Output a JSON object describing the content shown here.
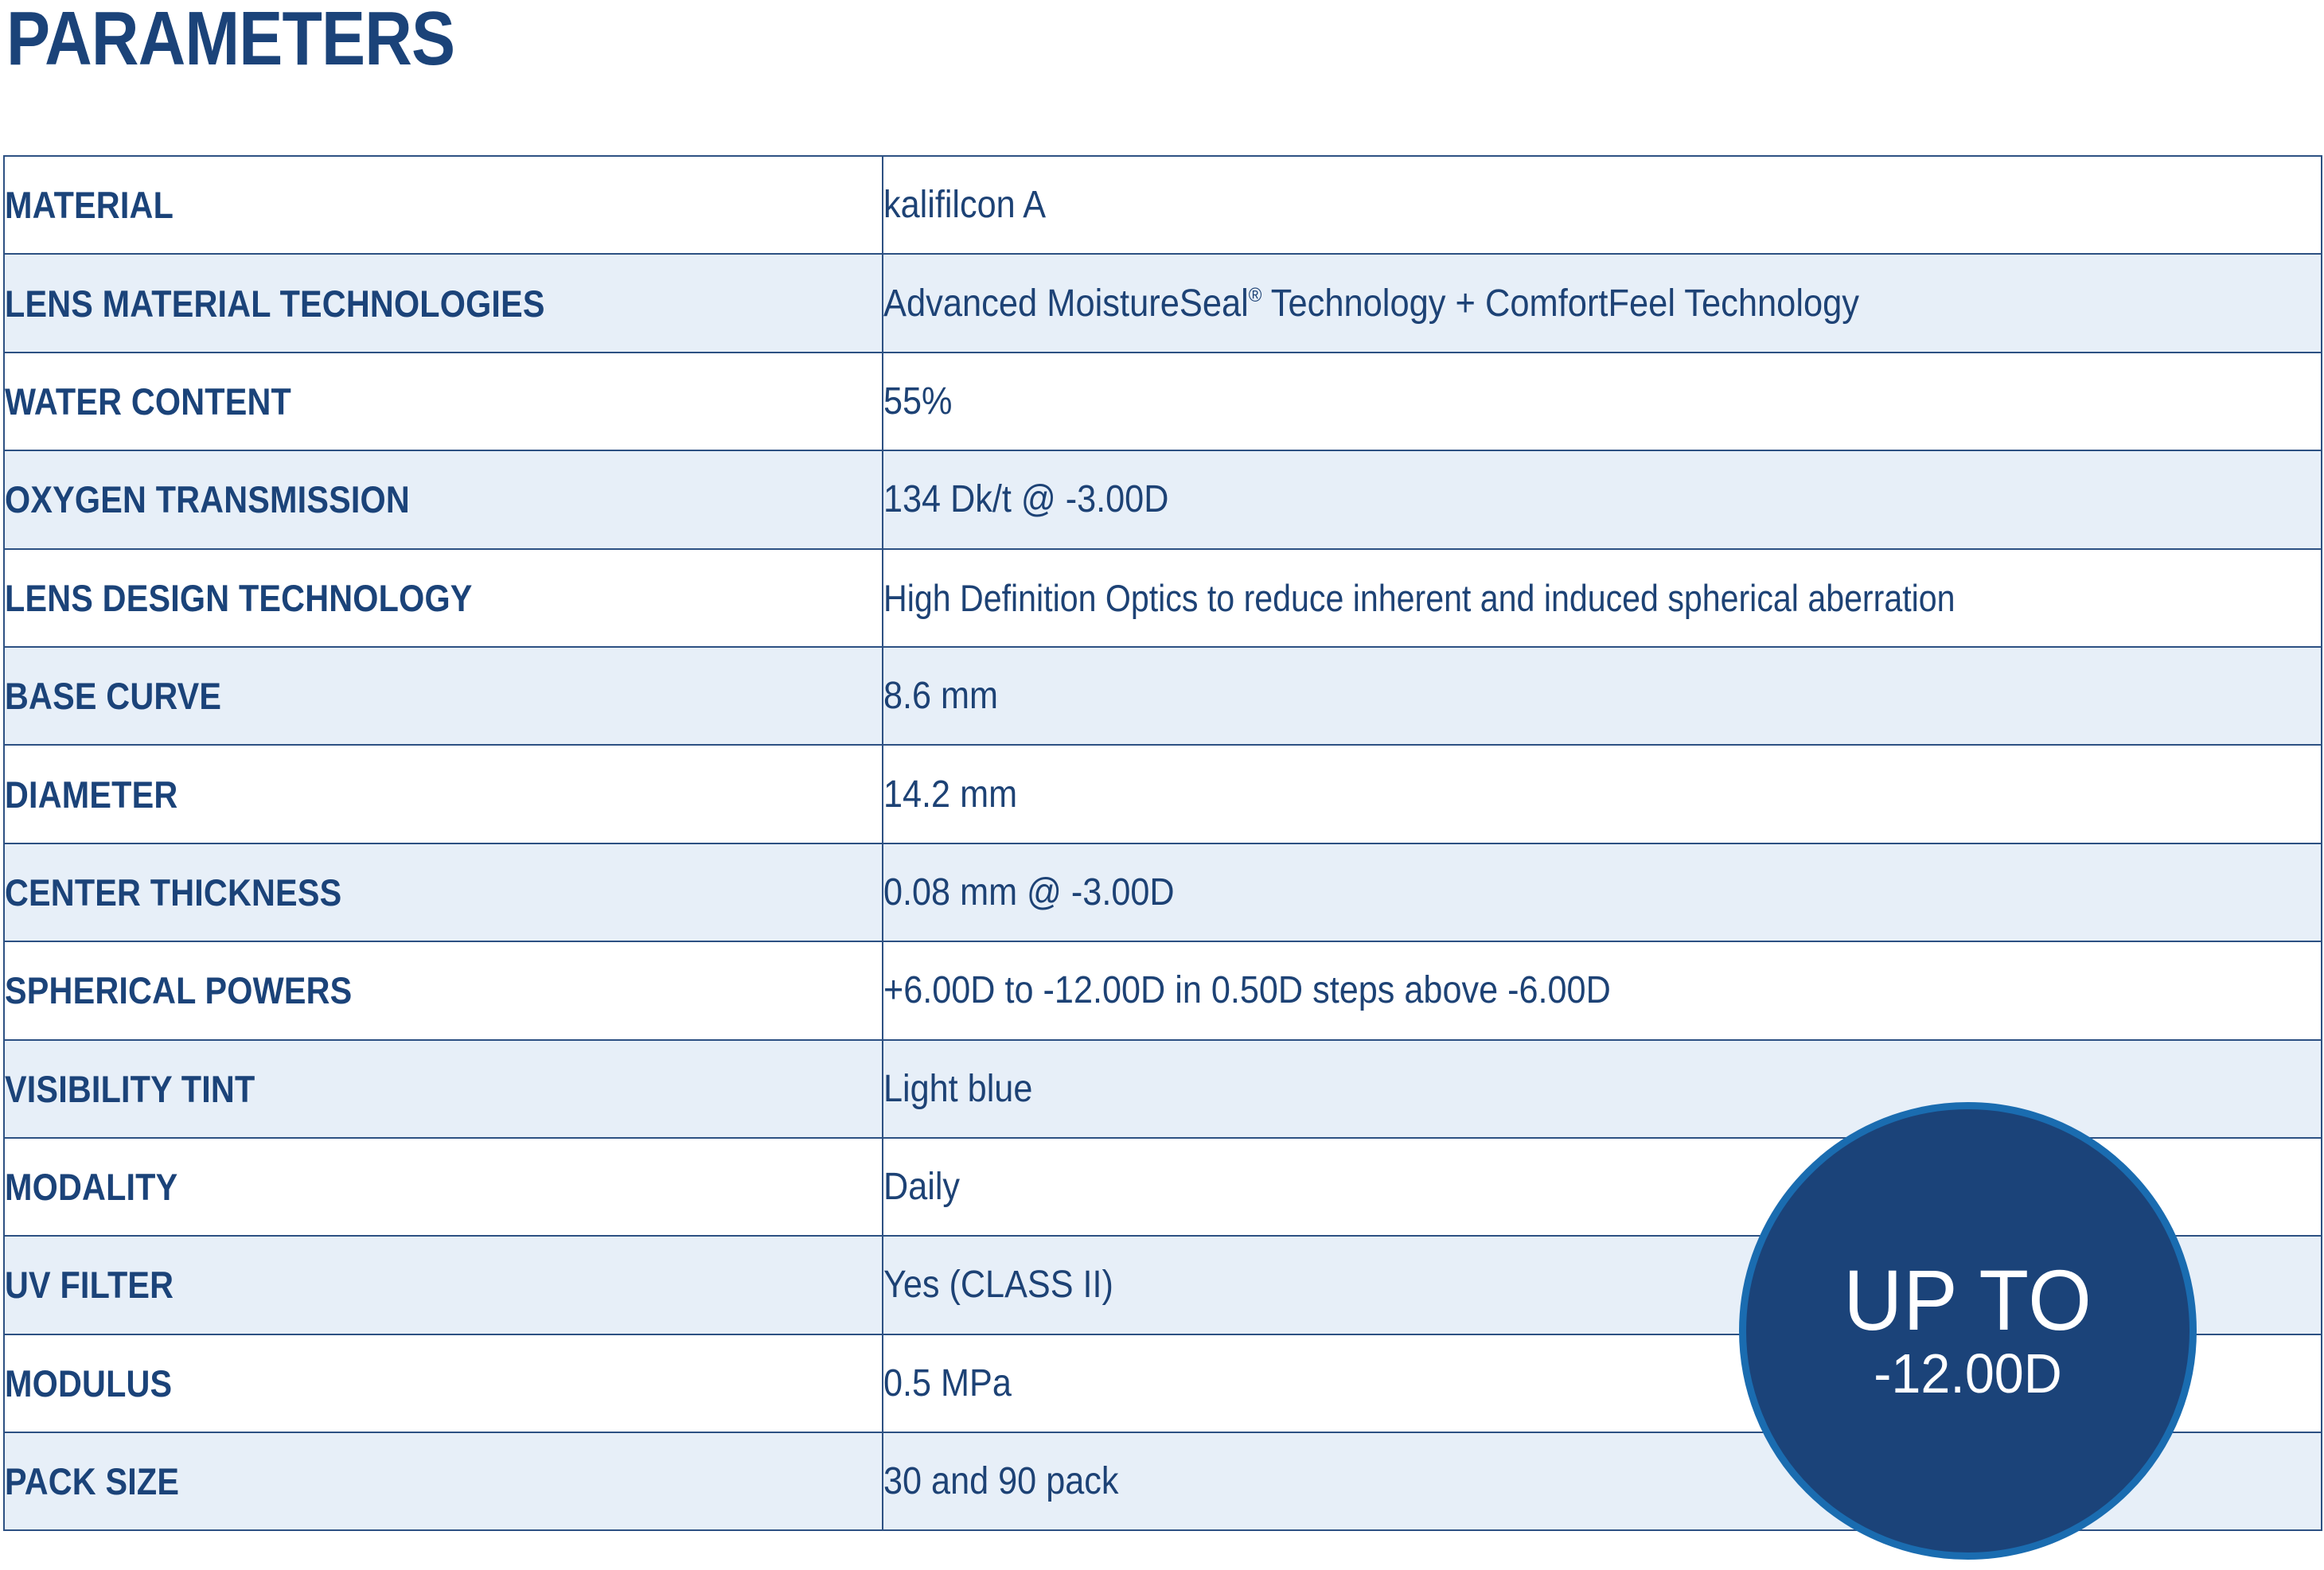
{
  "page": {
    "title": "PARAMETERS",
    "accent_navy": "#1b4379",
    "accent_blue_ring": "#1a6cb0",
    "stripe_color": "#e7eff8",
    "border_color": "#2d5183",
    "text_color": "#1d4275"
  },
  "table": {
    "columns": [
      "parameter",
      "value"
    ],
    "rows": [
      {
        "label": "MATERIAL",
        "value": "kalifilcon A",
        "striped": false
      },
      {
        "label": "LENS MATERIAL TECHNOLOGIES",
        "value": "Advanced MoistureSeal® Technology + ComfortFeel Technology",
        "striped": true
      },
      {
        "label": "WATER CONTENT",
        "value": "55%",
        "striped": false
      },
      {
        "label": "OXYGEN TRANSMISSION",
        "value": "134 Dk/t @ -3.00D",
        "striped": true
      },
      {
        "label": "LENS DESIGN TECHNOLOGY",
        "value": "High Definition Optics to reduce inherent and induced spherical aberration",
        "striped": false
      },
      {
        "label": "BASE CURVE",
        "value": "8.6 mm",
        "striped": true
      },
      {
        "label": "DIAMETER",
        "value": "14.2 mm",
        "striped": false
      },
      {
        "label": "CENTER THICKNESS",
        "value": "0.08 mm @ -3.00D",
        "striped": true
      },
      {
        "label": "SPHERICAL POWERS",
        "value": "+6.00D to -12.00D in 0.50D steps above -6.00D",
        "striped": false
      },
      {
        "label": "VISIBILITY TINT",
        "value": "Light blue",
        "striped": true
      },
      {
        "label": "MODALITY",
        "value": "Daily",
        "striped": false
      },
      {
        "label": "UV FILTER",
        "value": "Yes (CLASS II)",
        "striped": true
      },
      {
        "label": "MODULUS",
        "value": "0.5 MPa",
        "striped": false
      },
      {
        "label": "PACK SIZE",
        "value": "30 and 90 pack",
        "striped": true
      }
    ]
  },
  "badge": {
    "primary": "UP TO",
    "secondary": "-12.00D"
  }
}
